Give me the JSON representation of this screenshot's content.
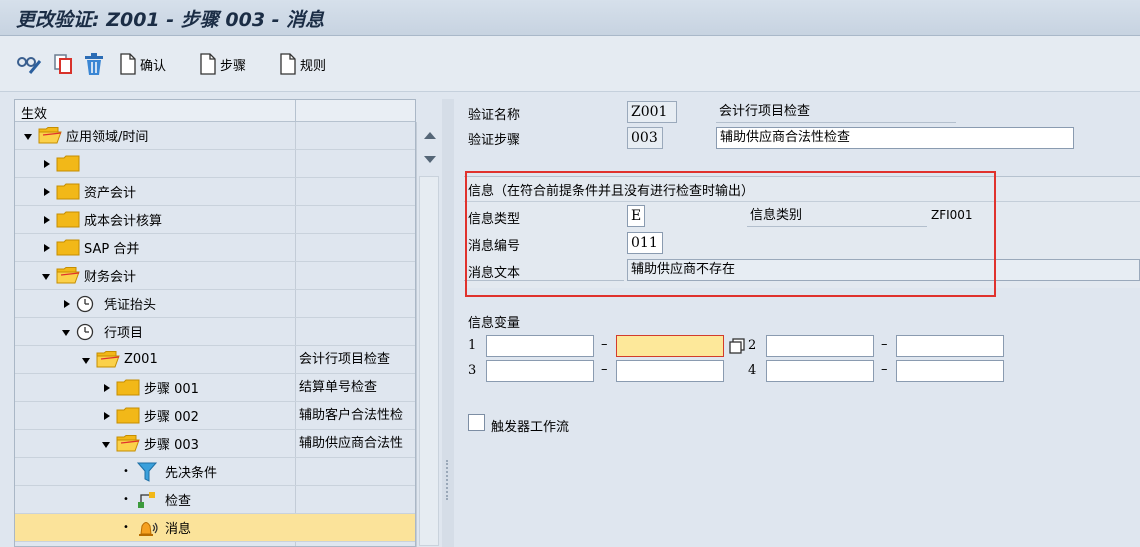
{
  "window": {
    "title": "更改验证: Z001 - 步骤 003 - 消息"
  },
  "toolbar": {
    "icons": [
      "glasses-pencil-icon",
      "copy-icon",
      "trash-icon"
    ],
    "buttons": [
      {
        "label": "确认",
        "icon": "document-icon"
      },
      {
        "label": "步骤",
        "icon": "document-icon"
      },
      {
        "label": "规则",
        "icon": "document-icon"
      }
    ]
  },
  "tree": {
    "header": "生效",
    "rows": [
      {
        "label": "应用领域/时间",
        "desc": "",
        "level": 0,
        "expander": "down",
        "icon": "folder-open-icon"
      },
      {
        "label": "",
        "desc": "",
        "level": 1,
        "expander": "right",
        "icon": "folder-icon"
      },
      {
        "label": "资产会计",
        "desc": "",
        "level": 1,
        "expander": "right",
        "icon": "folder-icon"
      },
      {
        "label": "成本会计核算",
        "desc": "",
        "level": 1,
        "expander": "right",
        "icon": "folder-icon"
      },
      {
        "label": "SAP 合并",
        "desc": "",
        "level": 1,
        "expander": "right",
        "icon": "folder-icon"
      },
      {
        "label": "财务会计",
        "desc": "",
        "level": 1,
        "expander": "down",
        "icon": "folder-open-icon"
      },
      {
        "label": "凭证抬头",
        "desc": "",
        "level": 2,
        "expander": "right",
        "icon": "clock-icon"
      },
      {
        "label": "行项目",
        "desc": "",
        "level": 2,
        "expander": "down",
        "icon": "clock-icon"
      },
      {
        "label": "Z001",
        "desc": "会计行项目检查",
        "level": 3,
        "expander": "down",
        "icon": "folder-open-icon"
      },
      {
        "label": "步骤 001",
        "desc": "结算单号检查",
        "level": 4,
        "expander": "right",
        "icon": "folder-icon"
      },
      {
        "label": "步骤 002",
        "desc": "辅助客户合法性检",
        "level": 4,
        "expander": "right",
        "icon": "folder-icon"
      },
      {
        "label": "步骤 003",
        "desc": "辅助供应商合法性",
        "level": 4,
        "expander": "down",
        "icon": "folder-open-icon"
      },
      {
        "label": "先决条件",
        "desc": "",
        "level": 5,
        "expander": "dot",
        "icon": "funnel-icon"
      },
      {
        "label": "检查",
        "desc": "",
        "level": 5,
        "expander": "dot",
        "icon": "hierarchy-icon"
      },
      {
        "label": "消息",
        "desc": "",
        "level": 5,
        "expander": "dot",
        "icon": "bell-icon",
        "selected": true
      }
    ]
  },
  "form": {
    "validation_name_label": "验证名称",
    "validation_name": "Z001",
    "validation_name_desc": "会计行项目检查",
    "validation_step_label": "验证步骤",
    "validation_step": "003",
    "validation_step_desc": "辅助供应商合法性检查",
    "message_group": {
      "title": "信息（在符合前提条件并且没有进行检查时输出）",
      "msg_type_label": "信息类型",
      "msg_type": "E",
      "msg_class_label": "信息类别",
      "msg_class": "ZFI001",
      "msg_number_label": "消息编号",
      "msg_number": "011",
      "msg_text_label": "消息文本",
      "msg_text": "辅助供应商不存在"
    },
    "variables": {
      "title": "信息变量",
      "rows": [
        {
          "n1": "1",
          "n2": "2",
          "a": "",
          "b": "",
          "c": "",
          "d": ""
        },
        {
          "n1": "3",
          "n2": "4",
          "a": "",
          "b": "",
          "c": "",
          "d": ""
        }
      ]
    },
    "workflow_label": "触发器工作流",
    "workflow_checked": false
  },
  "colors": {
    "highlight_border": "#e0322d",
    "selected_row": "#fbe39a",
    "focus_field": "#fde89a"
  }
}
